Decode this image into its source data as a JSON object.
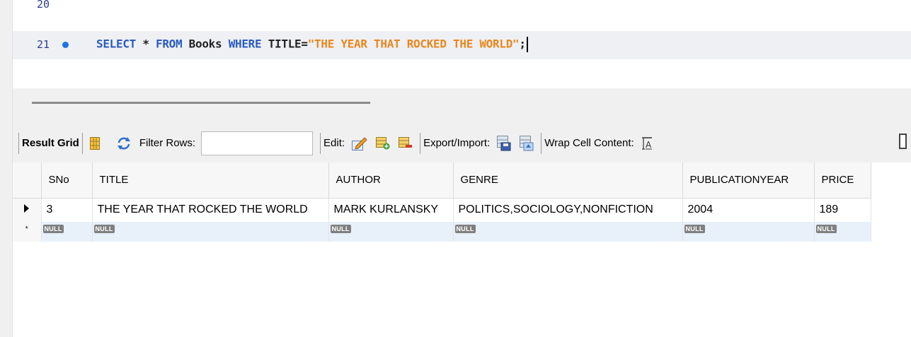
{
  "editor": {
    "lines": [
      {
        "number": "20"
      },
      {
        "number": "21"
      }
    ],
    "query": {
      "kw_select": "SELECT",
      "star": " * ",
      "kw_from": "FROM",
      "table": " Books ",
      "kw_where": "WHERE",
      "column": " TITLE=",
      "value": "\"THE YEAR THAT ROCKED THE WORLD\"",
      "end": ";"
    }
  },
  "toolbar": {
    "result_grid": "Result Grid",
    "filter_rows": "Filter Rows:",
    "filter_value": "",
    "edit": "Edit:",
    "export_import": "Export/Import:",
    "wrap_cell": "Wrap Cell Content:"
  },
  "grid": {
    "columns": [
      "SNo",
      "TITLE",
      "AUTHOR",
      "GENRE",
      "PUBLICATIONYEAR",
      "PRICE"
    ],
    "rows": [
      [
        "3",
        "THE YEAR THAT ROCKED THE WORLD",
        "MARK KURLANSKY",
        "POLITICS,SOCIOLOGY,NONFICTION",
        "2004",
        "189"
      ]
    ],
    "new_row": [
      "NULL",
      "NULL",
      "NULL",
      "NULL",
      "NULL",
      "NULL"
    ],
    "new_row_marker": "*"
  },
  "colors": {
    "keyword": "#2a5bbf",
    "string": "#e8871e",
    "breakpoint": "#1a73e8",
    "null_badge": "#7f7f7f"
  }
}
